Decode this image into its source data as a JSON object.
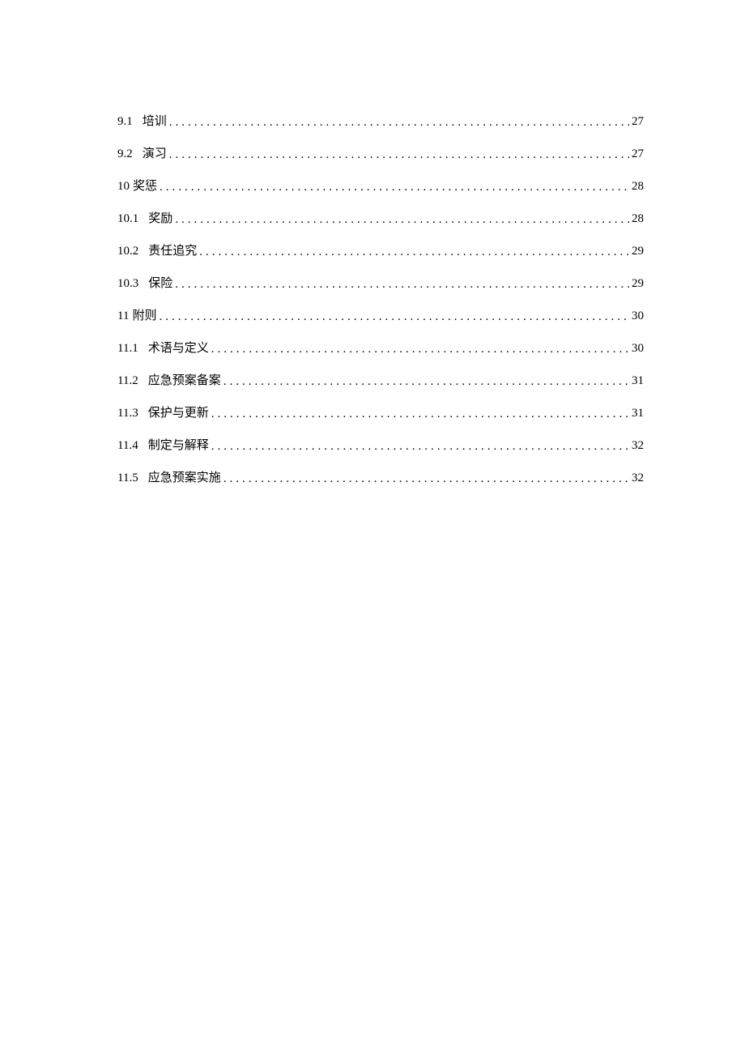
{
  "toc": [
    {
      "number": "9.1",
      "title": "培训",
      "page": "27",
      "spaced": true
    },
    {
      "number": "9.2",
      "title": "演习",
      "page": "27",
      "spaced": true
    },
    {
      "number": "10",
      "title": "奖惩",
      "page": "28",
      "spaced": false
    },
    {
      "number": "10.1",
      "title": "奖励",
      "page": "28",
      "spaced": true
    },
    {
      "number": "10.2",
      "title": "责任追究",
      "page": "29",
      "spaced": true
    },
    {
      "number": "10.3",
      "title": "保险",
      "page": "29",
      "spaced": true
    },
    {
      "number": "11",
      "title": "附则",
      "page": "30",
      "spaced": false
    },
    {
      "number": "11.1",
      "title": "术语与定义",
      "page": "30",
      "spaced": true
    },
    {
      "number": "11.2",
      "title": "应急预案备案",
      "page": "31",
      "spaced": true
    },
    {
      "number": "11.3",
      "title": "保护与更新",
      "page": "31",
      "spaced": true
    },
    {
      "number": "11.4",
      "title": "制定与解释",
      "page": "32",
      "spaced": true
    },
    {
      "number": "11.5",
      "title": "应急预案实施",
      "page": "32",
      "spaced": true
    }
  ]
}
